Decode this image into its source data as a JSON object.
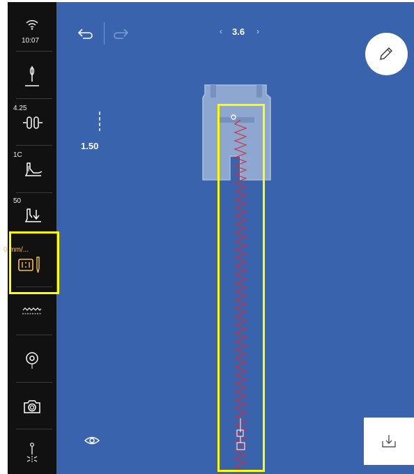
{
  "status": {
    "time": "10:07"
  },
  "sidebar": {
    "items": [
      {
        "name": "wifi-status",
        "value": "10:07"
      },
      {
        "name": "needle",
        "value": ""
      },
      {
        "name": "thread-tension",
        "value": "4.25"
      },
      {
        "name": "presser-foot",
        "value": "1C"
      },
      {
        "name": "presser-foot-pressure",
        "value": "50"
      },
      {
        "name": "needle-position",
        "value": "0 mm/...",
        "highlighted": true
      },
      {
        "name": "stitch-pattern",
        "value": ""
      },
      {
        "name": "bobbin",
        "value": ""
      },
      {
        "name": "camera",
        "value": ""
      },
      {
        "name": "needle-stop",
        "value": ""
      }
    ]
  },
  "toolbar": {
    "zoom_value": "3.6",
    "zoom_prev": "‹",
    "zoom_next": "›"
  },
  "scale": {
    "value": "1.50"
  },
  "colors": {
    "canvas": "#3a63ae",
    "sidebar": "#111112",
    "highlight": "#ffff00",
    "stitch": "#d32d3a",
    "active_label": "#f5c242"
  },
  "icons": [
    "undo-icon",
    "redo-icon",
    "pencil-icon",
    "download-icon",
    "eye-icon",
    "wifi-icon"
  ]
}
